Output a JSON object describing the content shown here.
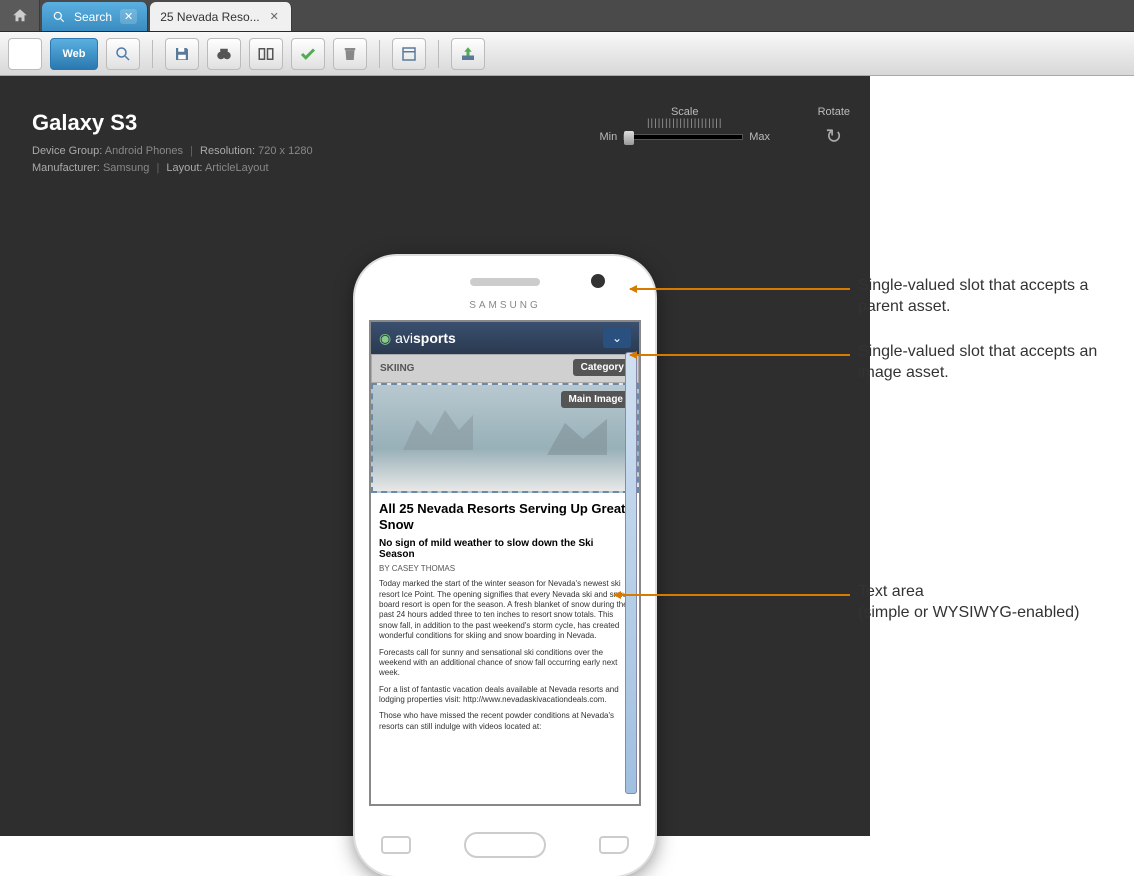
{
  "tabs": {
    "search": "Search",
    "active": "25 Nevada Reso..."
  },
  "toolbar": {
    "web": "Web"
  },
  "device": {
    "name": "Galaxy S3",
    "group_label": "Device Group:",
    "group": "Android Phones",
    "res_label": "Resolution:",
    "res": "720 x 1280",
    "manu_label": "Manufacturer:",
    "manu": "Samsung",
    "layout_label": "Layout:",
    "layout": "ArticleLayout",
    "brand": "SAMSUNG"
  },
  "controls": {
    "scale": "Scale",
    "min": "Min",
    "max": "Max",
    "rotate": "Rotate"
  },
  "screen": {
    "app_logo_a": "avi",
    "app_logo_b": "sports",
    "category_text": "SKIING",
    "badge_category": "Category",
    "badge_main_image": "Main Image",
    "headline": "All 25 Nevada Resorts Serving Up Great Snow",
    "subhead": "No sign of mild weather to slow down the Ski Season",
    "byline": "BY CASEY THOMAS",
    "p1": "Today marked the start of the winter season for Nevada's newest ski resort Ice Point. The opening signifies that every Nevada ski and snow board resort is open for the season. A fresh blanket of snow during the past 24 hours added three to ten inches to resort snow totals. This snow fall, in addition to the past weekend's storm cycle, has created wonderful conditions for skiing and snow boarding in Nevada.",
    "p2": "Forecasts call for sunny and sensational ski conditions over the weekend with an additional chance of snow fall occurring early next week.",
    "p3": "For a list of fantastic vacation deals available at Nevada resorts and lodging properties visit: http://www.nevadaskivacationdeals.com.",
    "p4": "Those who have missed the recent powder conditions at Nevada's resorts can still indulge with videos located at:"
  },
  "annotations": {
    "a1": "Single-valued slot that accepts a parent asset.",
    "a2": "Single-valued slot that accepts an image asset.",
    "a3": "Text area\n(simple or WYSIWYG-enabled)"
  }
}
